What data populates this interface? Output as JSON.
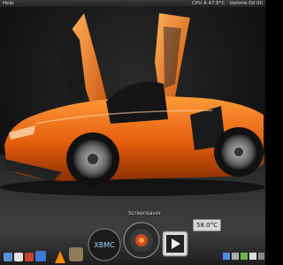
{
  "menubar": {
    "help_label": "Help",
    "cpu_text": "CPU A 47.6°C",
    "uptime_text": "Uptime 0d 0h"
  },
  "dock": {
    "hover_label": "Screensaver",
    "xbmc_label": "XBMC",
    "temperature_widget": "58.0°C"
  },
  "colors": {
    "car_body": "#e8600f",
    "accent": "#ff8a1f"
  }
}
